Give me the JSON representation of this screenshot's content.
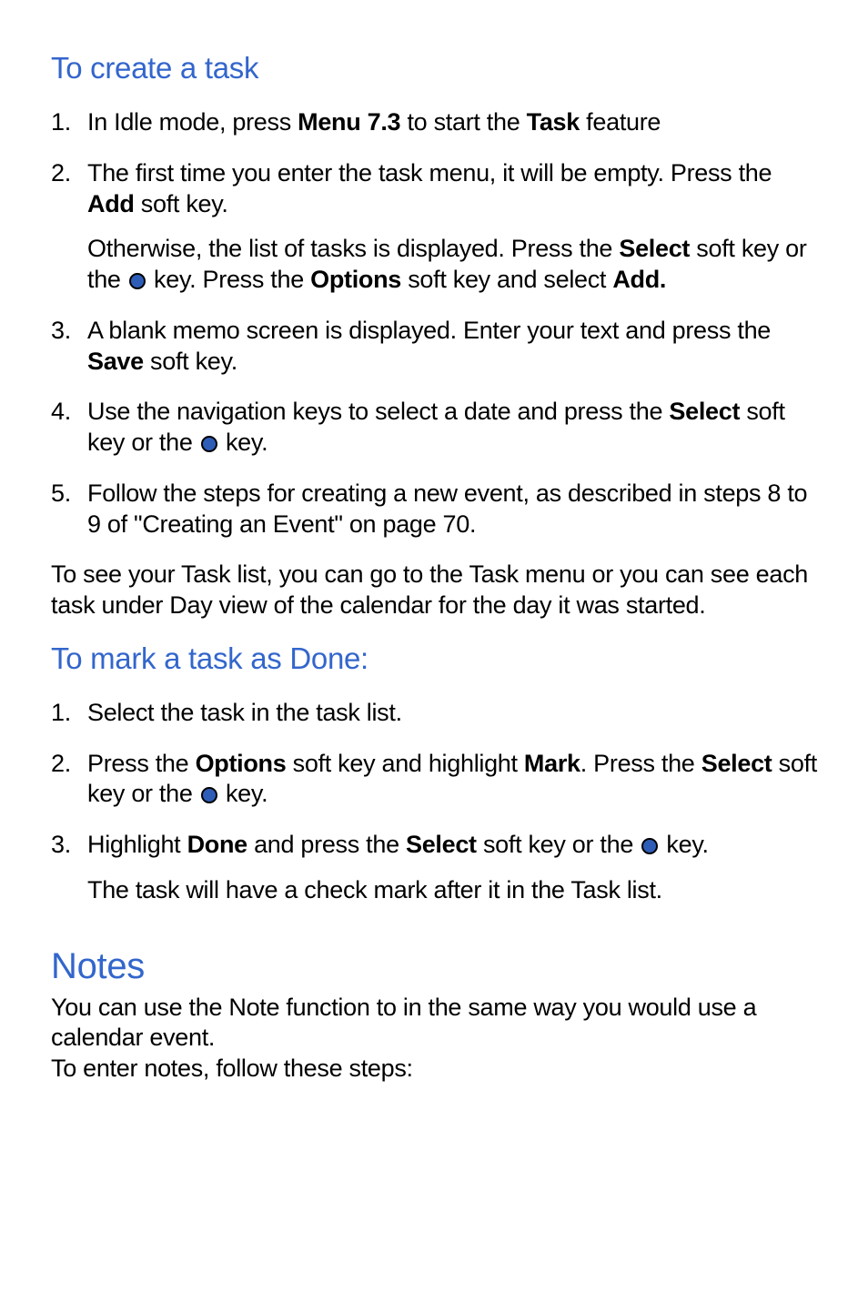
{
  "sections": {
    "create": {
      "heading": "To create a task",
      "li1": {
        "num": "1.",
        "t1": "In Idle mode, press ",
        "b1": "Menu 7.3",
        "t2": " to start the ",
        "b2": "Task",
        "t3": " feature"
      },
      "li2": {
        "num": "2.",
        "t1": "The first time you enter the task menu, it will be empty. Press the ",
        "b1": "Add",
        "t2": " soft key.",
        "sub_t1": "Otherwise, the list of tasks is displayed. Press the ",
        "sub_b1": "Select",
        "sub_t2": " soft key or the ",
        "sub_t3": " key. Press the ",
        "sub_b2": "Options",
        "sub_t4": " soft key and select ",
        "sub_b3": "Add."
      },
      "li3": {
        "num": "3.",
        "t1": "A blank memo screen is displayed. Enter your text and press the ",
        "b1": "Save",
        "t2": " soft key."
      },
      "li4": {
        "num": "4.",
        "t1": "Use the navigation keys to select a date and press the ",
        "b1": "Select",
        "t2": " soft key or the ",
        "t3": " key."
      },
      "li5": {
        "num": "5.",
        "t1": "Follow the steps for creating a new event, as described in steps 8 to 9 of \"Creating an Event\" on page 70."
      },
      "after": "To see your Task list, you can go to the Task menu or you can see each task under Day view of the calendar for the day it was started."
    },
    "mark": {
      "heading": "To mark a task as Done:",
      "li1": {
        "num": "1.",
        "t1": "Select the task in the task list."
      },
      "li2": {
        "num": "2.",
        "t1": "Press the ",
        "b1": "Options",
        "t2": " soft key and highlight ",
        "b2": "Mark",
        "t3": ". Press the ",
        "b3": "Select",
        "t4": " soft key or the ",
        "t5": " key."
      },
      "li3": {
        "num": "3.",
        "t1": "Highlight ",
        "b1": "Done",
        "t2": " and press the ",
        "b2": "Select",
        "t3": " soft key or the ",
        "t4": " key.",
        "sub": "The task will have a check mark after it in the Task list."
      }
    },
    "notes": {
      "heading": "Notes",
      "p1": "You can use the Note function to in the same way you would use a calendar event.",
      "p2": "To enter notes, follow these steps:"
    }
  }
}
